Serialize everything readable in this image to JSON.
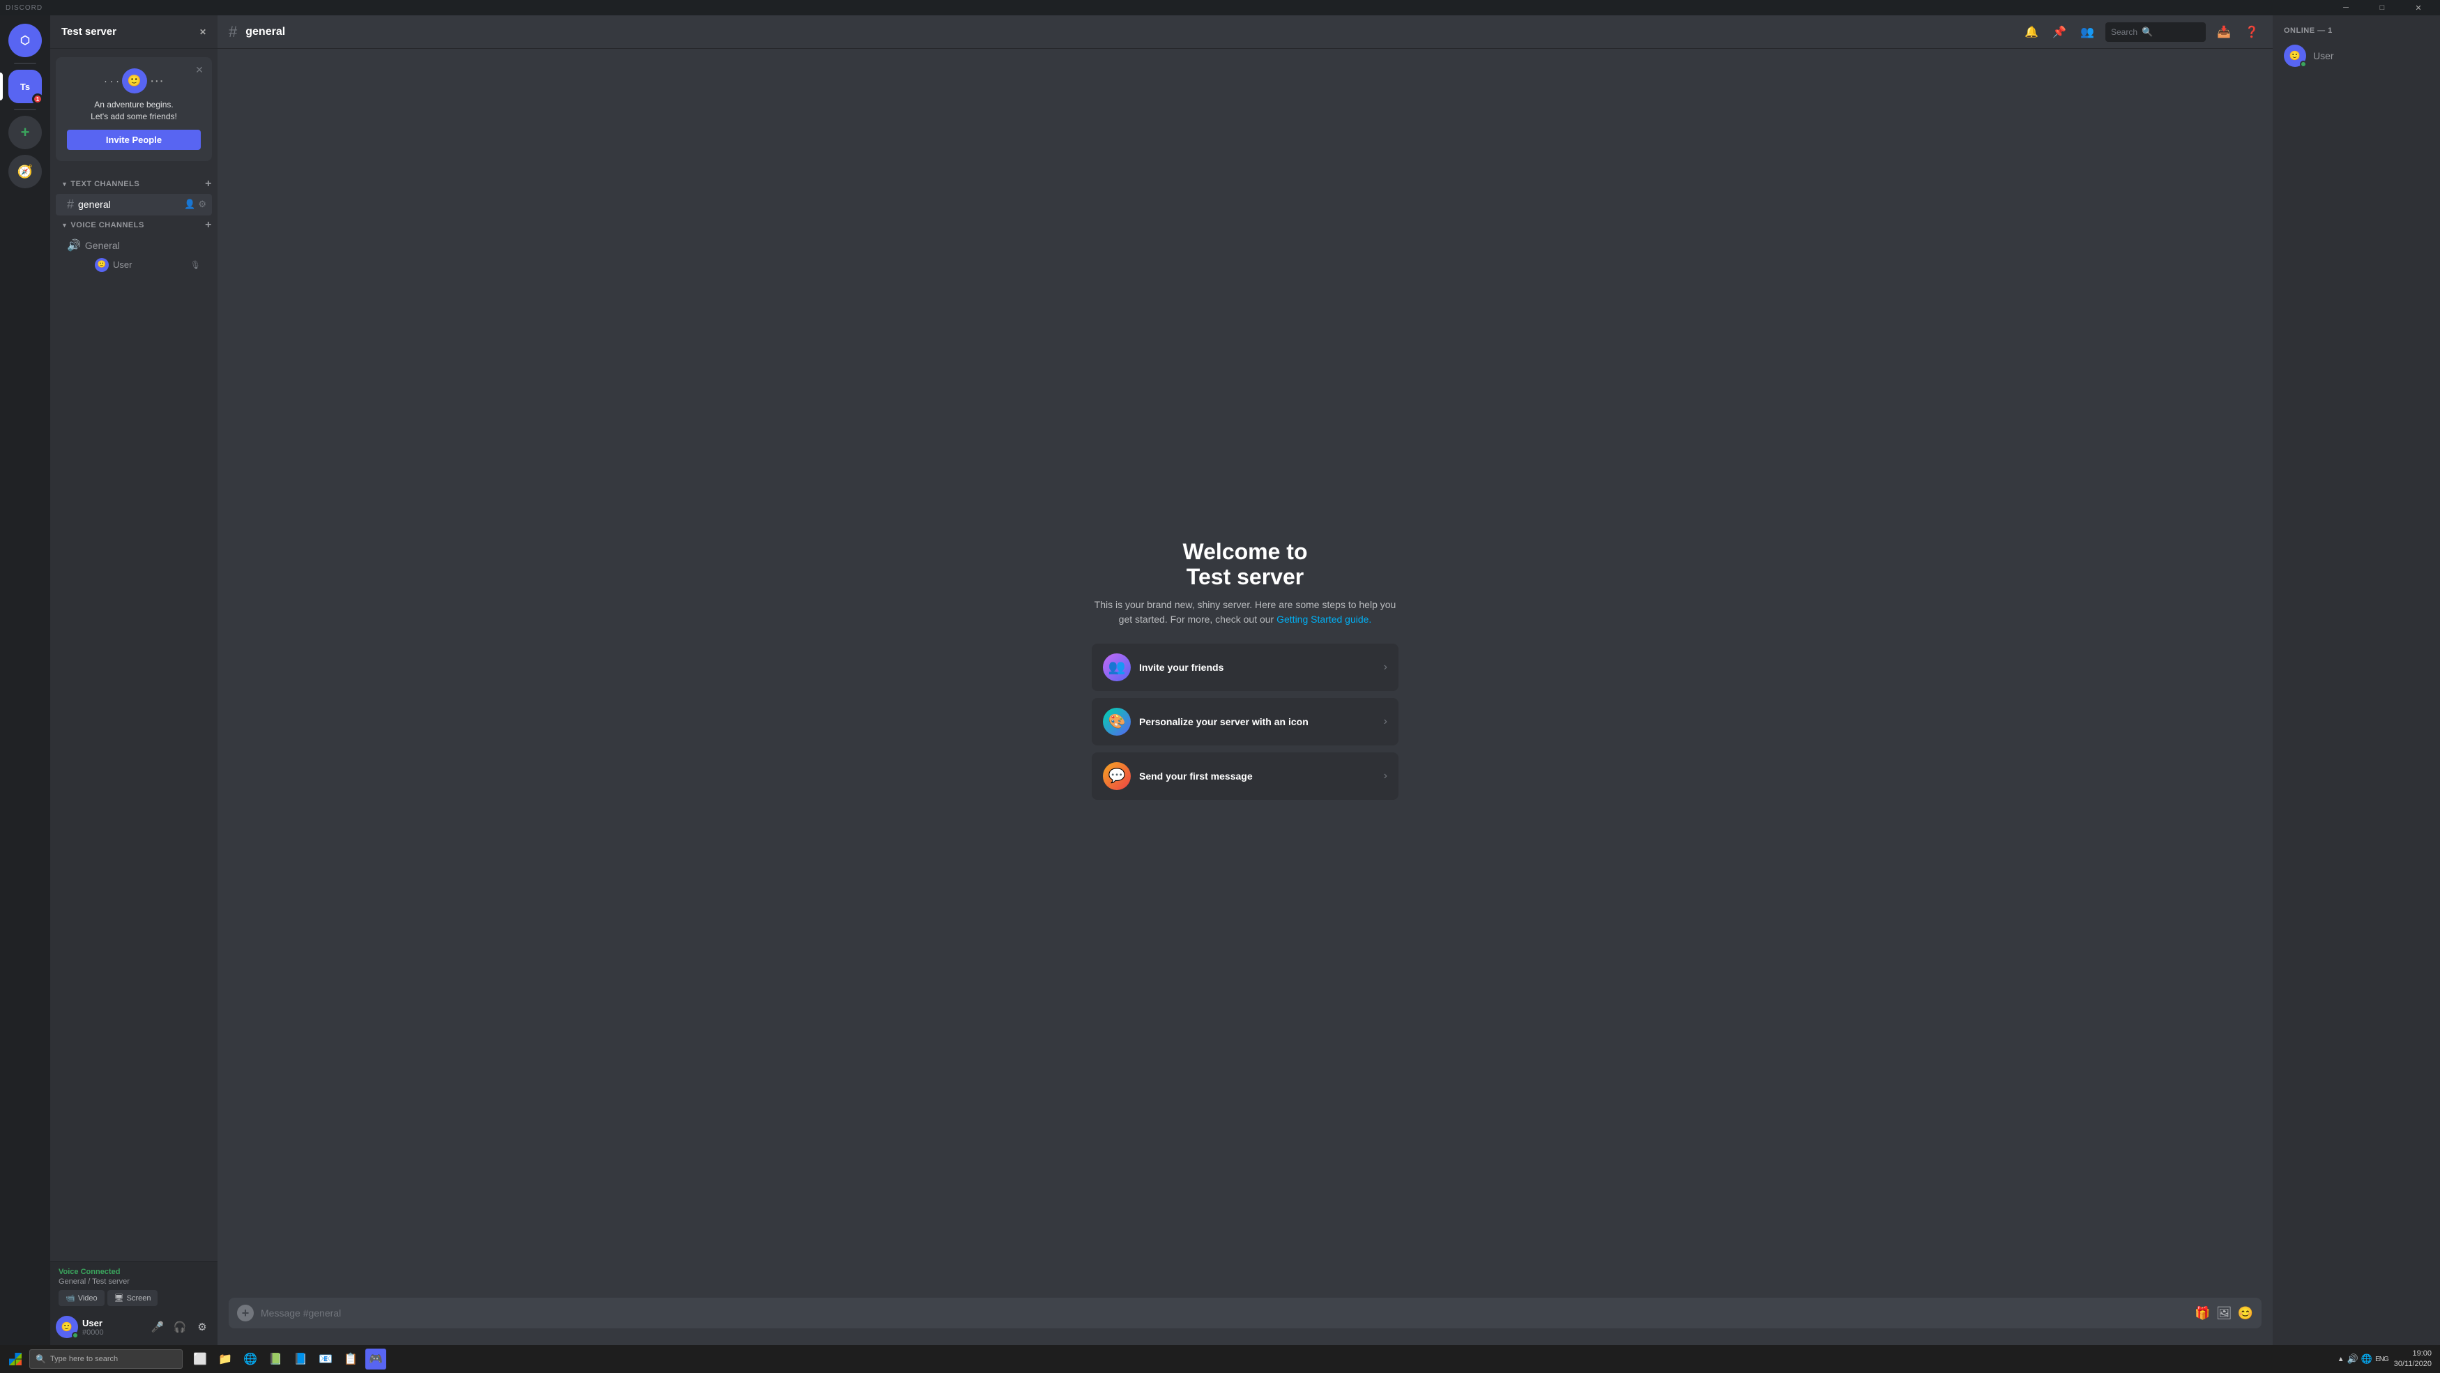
{
  "app": {
    "title": "DISCORD",
    "controls": {
      "minimize": "─",
      "maximize": "□",
      "close": "✕"
    }
  },
  "server_sidebar": {
    "discord_icon": "🎮",
    "servers": [
      {
        "id": "ts",
        "label": "Ts",
        "active": true,
        "notification": ""
      }
    ],
    "add_label": "+",
    "explore_label": "🧭"
  },
  "channel_sidebar": {
    "server_name": "Test server",
    "invite_popup": {
      "title": "An adventure begins.",
      "subtitle": "Let's add some friends!",
      "button_label": "Invite People"
    },
    "text_channels_label": "TEXT CHANNELS",
    "text_channels": [
      {
        "name": "general",
        "active": true
      }
    ],
    "voice_channels_label": "VOICE CHANNELS",
    "voice_channels": [
      {
        "name": "General",
        "users": [
          {
            "name": "User",
            "avatar": "🙂"
          }
        ]
      }
    ]
  },
  "voice_connected": {
    "status": "Voice Connected",
    "channel": "General",
    "server": "Test server",
    "video_label": "Video",
    "screen_label": "Screen"
  },
  "user_area": {
    "username": "User",
    "discriminator": "#0000",
    "avatar": "🙂"
  },
  "channel_header": {
    "hash": "#",
    "channel_name": "general",
    "search_placeholder": "Search"
  },
  "welcome": {
    "title_line1": "Welcome to",
    "title_line2": "Test server",
    "description": "This is your brand new, shiny server. Here are some steps to help you get started. For more, check out our",
    "link_text": "Getting Started guide.",
    "actions": [
      {
        "id": "invite",
        "label": "Invite your friends",
        "icon_type": "purple"
      },
      {
        "id": "personalize",
        "label": "Personalize your server with an icon",
        "icon_type": "cyan"
      },
      {
        "id": "message",
        "label": "Send your first message",
        "icon_type": "orange"
      }
    ]
  },
  "message_input": {
    "placeholder": "Message #general"
  },
  "member_sidebar": {
    "section_label": "ONLINE — 1",
    "members": [
      {
        "name": "User",
        "avatar": "🙂",
        "status": "online"
      }
    ]
  },
  "taskbar": {
    "search_placeholder": "Type here to search",
    "icons": [
      "⊞",
      "🔍",
      "⬛",
      "📁",
      "🌐",
      "📗",
      "📊",
      "✉",
      "📋",
      "🎮"
    ],
    "time": "19:00",
    "date": "30/11/2020",
    "sys_icons": [
      "^",
      "🔊",
      "🌐",
      "ENG"
    ]
  }
}
